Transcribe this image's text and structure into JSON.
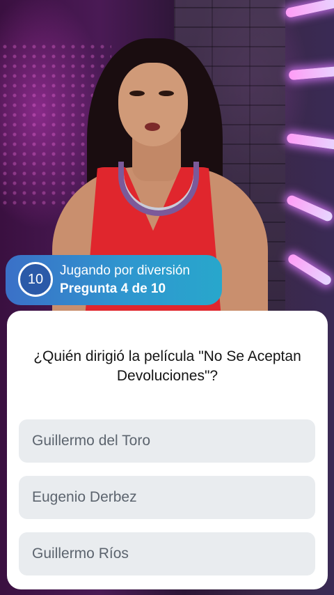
{
  "status": {
    "timer_seconds": "10",
    "mode_label": "Jugando por diversión",
    "progress_label": "Pregunta 4 de 10"
  },
  "question": {
    "text": "¿Quién dirigió la película \"No Se Aceptan Devoluciones\"?"
  },
  "options": [
    {
      "label": "Guillermo del Toro"
    },
    {
      "label": "Eugenio Derbez"
    },
    {
      "label": "Guillermo Ríos"
    }
  ],
  "colors": {
    "pill_gradient_start": "#3b70c7",
    "pill_gradient_end": "#28a7cc",
    "card_background": "#ffffff",
    "option_background": "#e9ecef",
    "option_text": "#5c646e"
  }
}
